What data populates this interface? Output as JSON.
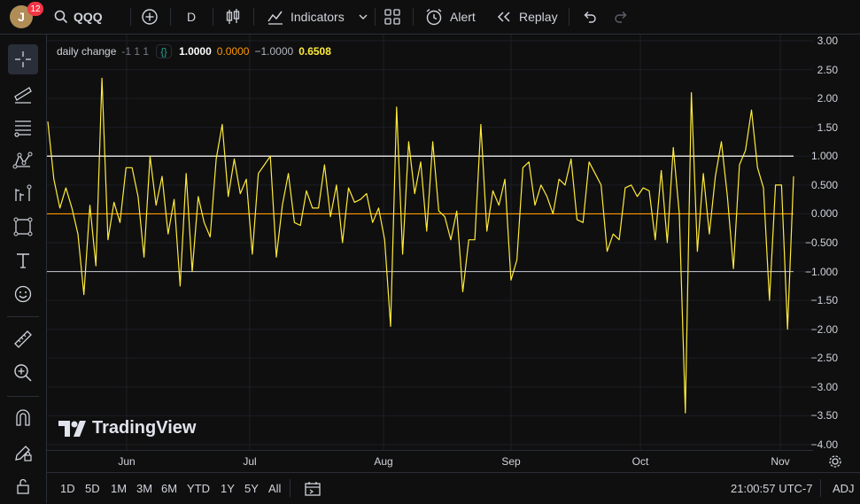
{
  "topbar": {
    "avatar_letter": "J",
    "notification_count": "12",
    "symbol": "QQQ",
    "interval": "D",
    "indicators_label": "Indicators",
    "alert_label": "Alert",
    "replay_label": "Replay"
  },
  "legend": {
    "name": "daily change",
    "params": "-1 1 1",
    "values": [
      "1.0000",
      "0.0000",
      "−1.0000",
      "0.6508"
    ],
    "value_colors": [
      "#ffffff",
      "#ff9800",
      "#b2b5be",
      "#ffeb3b"
    ]
  },
  "y_axis": {
    "labels": [
      "3.00",
      "2.50",
      "2.00",
      "1.50",
      "1.000",
      "0.500",
      "0.000",
      "−0.500",
      "−1.000",
      "−1.50",
      "−2.00",
      "−2.50",
      "−3.00",
      "−3.50",
      "−4.00"
    ]
  },
  "x_axis": {
    "labels": [
      "Jun",
      "Jul",
      "Aug",
      "Sep",
      "Oct",
      "Nov"
    ]
  },
  "watermark": "TradingView",
  "bottombar": {
    "ranges": [
      "1D",
      "5D",
      "1M",
      "3M",
      "6M",
      "YTD",
      "1Y",
      "5Y",
      "All"
    ],
    "time": "21:00:57 UTC-7",
    "adj_label": "ADJ"
  },
  "chart_data": {
    "type": "line",
    "title": "daily change",
    "ylim": [
      -4,
      3
    ],
    "x_ticks": [
      "Jun",
      "Jul",
      "Aug",
      "Sep",
      "Oct",
      "Nov"
    ],
    "reference_lines": [
      {
        "value": 1.0,
        "color": "#ffffff"
      },
      {
        "value": 0.0,
        "color": "#ff9800"
      },
      {
        "value": -1.0,
        "color": "#b2b5be"
      }
    ],
    "series": [
      {
        "color": "#ffeb3b",
        "values": [
          1.6,
          0.6,
          0.1,
          0.45,
          0.1,
          -0.35,
          -1.4,
          0.15,
          -0.9,
          2.35,
          -0.45,
          0.2,
          -0.15,
          0.8,
          0.8,
          0.3,
          -0.75,
          1.0,
          0.15,
          0.65,
          -0.35,
          0.25,
          -1.25,
          0.7,
          -1.0,
          0.3,
          -0.15,
          -0.4,
          0.95,
          1.55,
          0.3,
          0.95,
          0.35,
          0.6,
          -0.7,
          0.7,
          0.85,
          1.0,
          -0.75,
          0.15,
          0.7,
          -0.15,
          -0.2,
          0.4,
          0.1,
          0.1,
          0.85,
          -0.05,
          0.5,
          -0.5,
          0.45,
          0.2,
          0.25,
          0.35,
          -0.15,
          0.1,
          -0.45,
          -1.95,
          1.85,
          -0.7,
          1.25,
          0.35,
          0.9,
          -0.3,
          1.25,
          0.05,
          -0.05,
          -0.45,
          0.05,
          -1.35,
          -0.45,
          -0.45,
          1.55,
          -0.3,
          0.4,
          0.15,
          0.6,
          -1.15,
          -0.8,
          0.8,
          0.9,
          0.15,
          0.5,
          0.3,
          0.0,
          0.6,
          0.5,
          0.95,
          -0.1,
          -0.15,
          0.9,
          0.7,
          0.5,
          -0.65,
          -0.35,
          -0.45,
          0.45,
          0.5,
          0.3,
          0.45,
          0.4,
          -0.45,
          0.75,
          -0.5,
          1.15,
          0.0,
          -3.45,
          2.1,
          -0.65,
          0.7,
          -0.35,
          0.65,
          1.25,
          0.3,
          -0.95,
          0.85,
          1.1,
          1.8,
          0.8,
          0.45,
          -1.5,
          0.5,
          0.5,
          -2.0,
          0.65
        ]
      }
    ]
  }
}
